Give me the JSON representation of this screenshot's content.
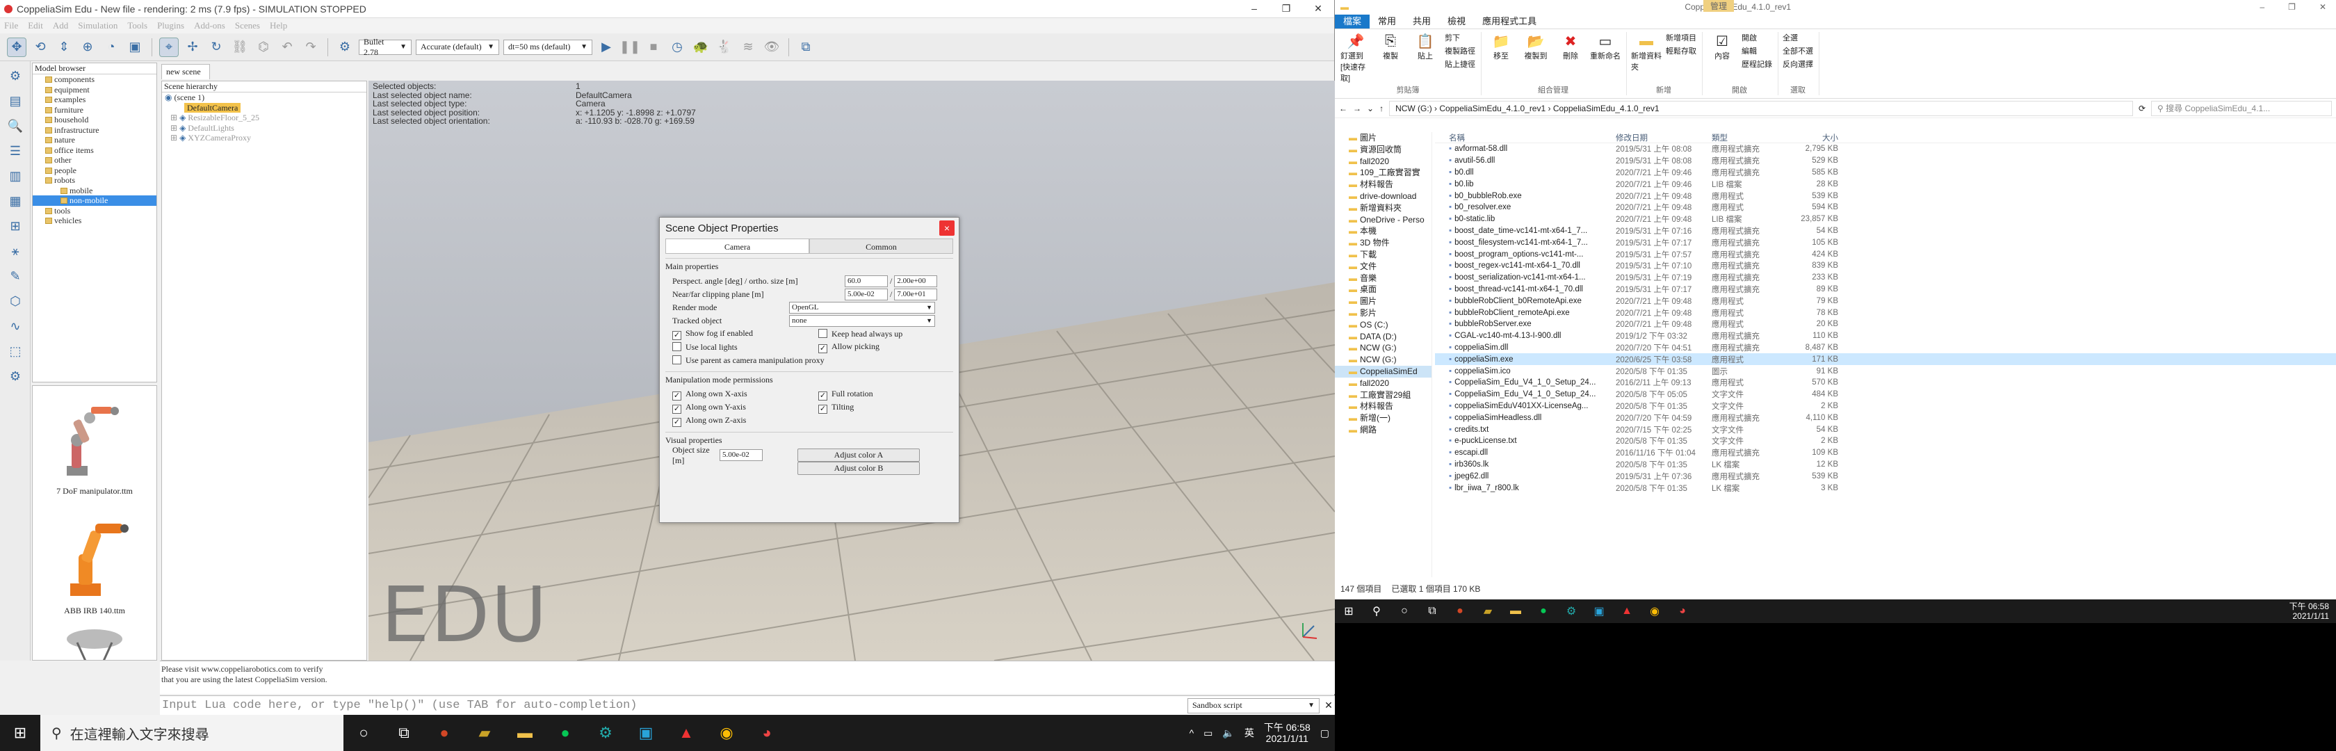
{
  "cs": {
    "title": "CoppeliaSim Edu - New file - rendering: 2 ms (7.9 fps) - SIMULATION STOPPED",
    "menu": [
      "File",
      "Edit",
      "Add",
      "Simulation",
      "Tools",
      "Plugins",
      "Add-ons",
      "Scenes",
      "Help"
    ],
    "engine": "Bullet 2.78",
    "accuracy": "Accurate (default)",
    "dt": "dt=50 ms (default)",
    "model_browser_title": "Model browser",
    "model_tree": [
      "components",
      "equipment",
      "examples",
      "furniture",
      "household",
      "infrastructure",
      "nature",
      "office items",
      "other",
      "people",
      "robots",
      "mobile",
      "non-mobile",
      "tools",
      "vehicles"
    ],
    "thumbs": [
      "7 DoF manipulator.ttm",
      "ABB IRB 140.ttm"
    ],
    "scene_tab": "new scene",
    "scene_hier_title": "Scene hierarchy",
    "scene_items": [
      "(scene 1)",
      "DefaultCamera",
      "ResizableFloor_5_25",
      "DefaultLights",
      "XYZCameraProxy"
    ],
    "info": [
      [
        "Selected objects:",
        "1"
      ],
      [
        "Last selected object name:",
        "DefaultCamera"
      ],
      [
        "Last selected object type:",
        "Camera"
      ],
      [
        "Last selected object position:",
        "x: +1.1205   y: -1.8998   z: +1.0797"
      ],
      [
        "Last selected object orientation:",
        "a: -110.93   b: -028.70   g: +169.59"
      ]
    ],
    "edu": "EDU",
    "dialog": {
      "title": "Scene Object Properties",
      "close": "×",
      "tab_camera": "Camera",
      "tab_common": "Common",
      "main_title": "Main properties",
      "persp_label": "Perspect. angle [deg] / ortho. size [m]",
      "persp_a": "60.0",
      "persp_b": "2.00e+00",
      "clip_label": "Near/far clipping plane [m]",
      "clip_a": "5.00e-02",
      "clip_b": "7.00e+01",
      "render_label": "Render mode",
      "render_val": "OpenGL",
      "tracked_label": "Tracked object",
      "tracked_val": "none",
      "show_fog": "Show fog if enabled",
      "keep_head": "Keep head always up",
      "local_lights": "Use local lights",
      "allow_picking": "Allow picking",
      "use_parent": "Use parent as camera manipulation proxy",
      "manip_title": "Manipulation mode permissions",
      "along_x": "Along own X-axis",
      "along_y": "Along own Y-axis",
      "along_z": "Along own Z-axis",
      "full_rot": "Full rotation",
      "tilting": "Tilting",
      "visual_title": "Visual properties",
      "obj_size_label": "Object size [m]",
      "obj_size": "5.00e-02",
      "adj_a": "Adjust color A",
      "adj_b": "Adjust color B"
    },
    "status_lines": [
      "Please visit www.coppeliarobotics.com to verify",
      "that you are using the latest CoppeliaSim version."
    ],
    "lua_placeholder": "Input Lua code here, or type \"help()\" (use TAB for auto-completion)",
    "sandbox": "Sandbox script"
  },
  "taskbar_left": {
    "search": "在這裡輸入文字來搜尋",
    "time": "下午 06:58",
    "date": "2021/1/11",
    "lang": "英"
  },
  "explorer": {
    "title": "CoppeliaSimEdu_4.1.0_rev1",
    "manage": "管理",
    "tabs": [
      "檔案",
      "常用",
      "共用",
      "檢視",
      "應用程式工具"
    ],
    "ribbon": {
      "pin": "釘選到[快速存取]",
      "copy": "複製",
      "paste": "貼上",
      "cut": "剪下",
      "copypath": "複製路徑",
      "pasteshortcut": "貼上捷徑",
      "move": "移至",
      "copyto": "複製到",
      "delete": "刪除",
      "rename": "重新命名",
      "newfolder": "新增資料夾",
      "newitem": "新增項目",
      "easyaccess": "輕鬆存取",
      "properties": "內容",
      "open": "開啟",
      "edit": "編輯",
      "history": "歷程記錄",
      "selectall": "全選",
      "selectnone": "全部不選",
      "invert": "反向選擇",
      "g1": "剪貼簿",
      "g2": "組合管理",
      "g3": "新增",
      "g4": "開啟",
      "g5": "選取"
    },
    "path": [
      "NCW (G:)",
      "CoppeliaSimEdu_4.1.0_rev1",
      "CoppeliaSimEdu_4.1.0_rev1"
    ],
    "search": "搜尋 CoppeliaSimEdu_4.1...",
    "nav": [
      "圖片",
      "資源回收筒",
      "fall2020",
      "109_工廠實習實",
      "材料報告",
      "drive-download",
      "新增資料夾",
      "OneDrive - Perso",
      "本機",
      "3D 物件",
      "下載",
      "文件",
      "音樂",
      "桌面",
      "圖片",
      "影片",
      "OS (C:)",
      "DATA (D:)",
      "NCW (G:)",
      "NCW (G:)",
      "CoppeliaSimEd",
      "fall2020",
      "工廠實習29組",
      "材料報告",
      "新增(一)",
      "網路"
    ],
    "cols": [
      "名稱",
      "修改日期",
      "類型",
      "大小"
    ],
    "files": [
      [
        "avformat-58.dll",
        "2019/5/31 上午 08:08",
        "應用程式擴充",
        "2,795 KB"
      ],
      [
        "avutil-56.dll",
        "2019/5/31 上午 08:08",
        "應用程式擴充",
        "529 KB"
      ],
      [
        "b0.dll",
        "2020/7/21 上午 09:46",
        "應用程式擴充",
        "585 KB"
      ],
      [
        "b0.lib",
        "2020/7/21 上午 09:46",
        "LIB 檔案",
        "28 KB"
      ],
      [
        "b0_bubbleRob.exe",
        "2020/7/21 上午 09:48",
        "應用程式",
        "539 KB"
      ],
      [
        "b0_resolver.exe",
        "2020/7/21 上午 09:48",
        "應用程式",
        "594 KB"
      ],
      [
        "b0-static.lib",
        "2020/7/21 上午 09:48",
        "LIB 檔案",
        "23,857 KB"
      ],
      [
        "boost_date_time-vc141-mt-x64-1_7...",
        "2019/5/31 上午 07:16",
        "應用程式擴充",
        "54 KB"
      ],
      [
        "boost_filesystem-vc141-mt-x64-1_7...",
        "2019/5/31 上午 07:17",
        "應用程式擴充",
        "105 KB"
      ],
      [
        "boost_program_options-vc141-mt-...",
        "2019/5/31 上午 07:57",
        "應用程式擴充",
        "424 KB"
      ],
      [
        "boost_regex-vc141-mt-x64-1_70.dll",
        "2019/5/31 上午 07:10",
        "應用程式擴充",
        "839 KB"
      ],
      [
        "boost_serialization-vc141-mt-x64-1...",
        "2019/5/31 上午 07:19",
        "應用程式擴充",
        "233 KB"
      ],
      [
        "boost_thread-vc141-mt-x64-1_70.dll",
        "2019/5/31 上午 07:17",
        "應用程式擴充",
        "89 KB"
      ],
      [
        "bubbleRobClient_b0RemoteApi.exe",
        "2020/7/21 上午 09:48",
        "應用程式",
        "79 KB"
      ],
      [
        "bubbleRobClient_remoteApi.exe",
        "2020/7/21 上午 09:48",
        "應用程式",
        "78 KB"
      ],
      [
        "bubbleRobServer.exe",
        "2020/7/21 上午 09:48",
        "應用程式",
        "20 KB"
      ],
      [
        "CGAL-vc140-mt-4.13-I-900.dll",
        "2019/1/2 下午 03:32",
        "應用程式擴充",
        "110 KB"
      ],
      [
        "coppeliaSim.dll",
        "2020/7/20 下午 04:51",
        "應用程式擴充",
        "8,487 KB"
      ],
      [
        "coppeliaSim.exe",
        "2020/6/25 下午 03:58",
        "應用程式",
        "171 KB"
      ],
      [
        "coppeliaSim.ico",
        "2020/5/8 下午 01:35",
        "圖示",
        "91 KB"
      ],
      [
        "CoppeliaSim_Edu_V4_1_0_Setup_24...",
        "2016/2/11 上午 09:13",
        "應用程式",
        "570 KB"
      ],
      [
        "CoppeliaSim_Edu_V4_1_0_Setup_24...",
        "2020/5/8 下午 05:05",
        "文字文件",
        "484 KB"
      ],
      [
        "coppeliaSimEduV401XX-LicenseAg...",
        "2020/5/8 下午 01:35",
        "文字文件",
        "2 KB"
      ],
      [
        "coppeliaSimHeadless.dll",
        "2020/7/20 下午 04:59",
        "應用程式擴充",
        "4,110 KB"
      ],
      [
        "credits.txt",
        "2020/7/15 下午 02:25",
        "文字文件",
        "54 KB"
      ],
      [
        "e-puckLicense.txt",
        "2020/5/8 下午 01:35",
        "文字文件",
        "2 KB"
      ],
      [
        "escapi.dll",
        "2016/11/16 下午 01:04",
        "應用程式擴充",
        "109 KB"
      ],
      [
        "irb360s.lk",
        "2020/5/8 下午 01:35",
        "LK 檔案",
        "12 KB"
      ],
      [
        "jpeg62.dll",
        "2019/5/31 上午 07:36",
        "應用程式擴充",
        "539 KB"
      ],
      [
        "lbr_iiwa_7_r800.lk",
        "2020/5/8 下午 01:35",
        "LK 檔案",
        "3 KB"
      ]
    ],
    "status": [
      "147 個項目",
      "已選取 1 個項目 170 KB"
    ]
  },
  "taskbar_right": {
    "time": "下午 06:58",
    "date": "2021/1/11"
  },
  "colors": {
    "accent": "#1979ca",
    "selection": "#3a8ee6"
  }
}
